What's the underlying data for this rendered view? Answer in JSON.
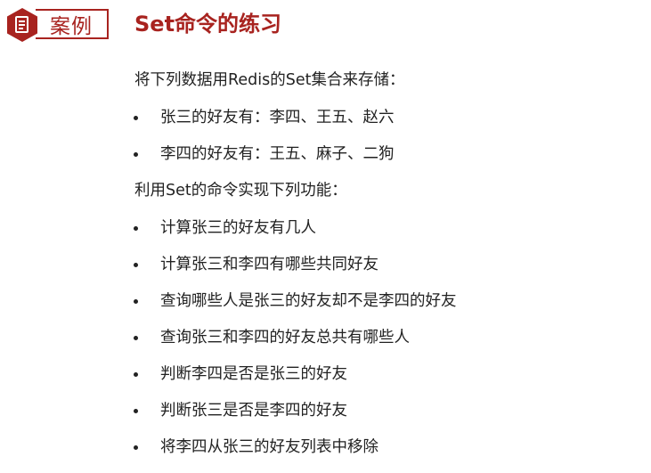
{
  "header": {
    "badge_label": "案例",
    "title": "Set命令的练习"
  },
  "colors": {
    "accent": "#a8231f",
    "text": "#222222"
  },
  "icons": {
    "badge_icon": "document-icon"
  },
  "content": {
    "intro": "将下列数据用Redis的Set集合来存储：",
    "data_items": [
      "张三的好友有：李四、王五、赵六",
      "李四的好友有：王五、麻子、二狗"
    ],
    "tasks_intro": "利用Set的命令实现下列功能：",
    "tasks": [
      "计算张三的好友有几人",
      "计算张三和李四有哪些共同好友",
      "查询哪些人是张三的好友却不是李四的好友",
      "查询张三和李四的好友总共有哪些人",
      "判断李四是否是张三的好友",
      "判断张三是否是李四的好友",
      "将李四从张三的好友列表中移除"
    ]
  }
}
